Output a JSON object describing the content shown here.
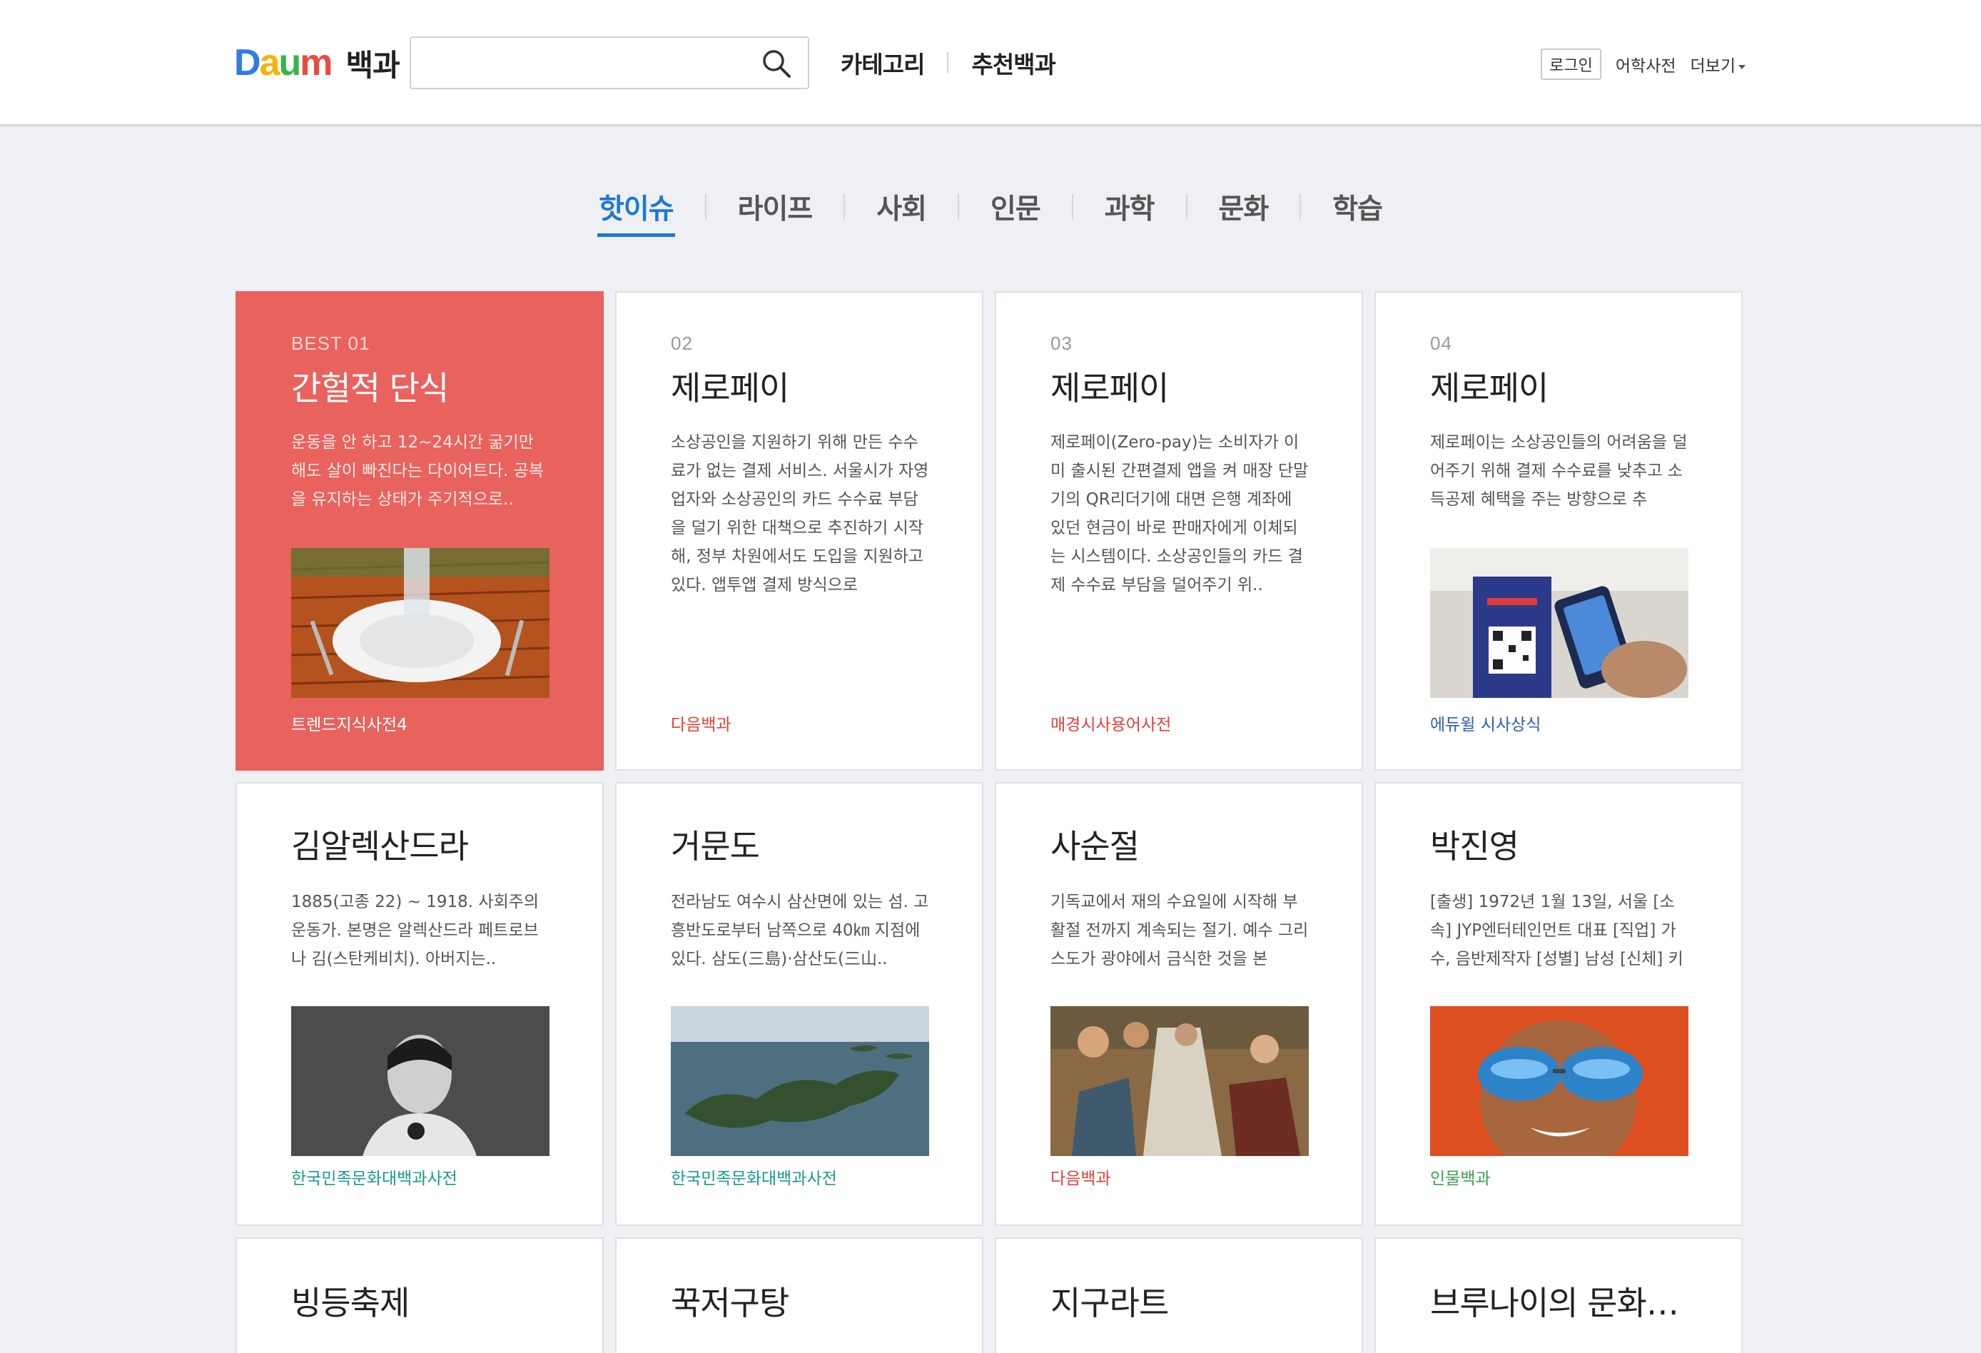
{
  "header": {
    "logo_letters": [
      "D",
      "a",
      "u",
      "m"
    ],
    "logo_title": "백과",
    "search": {
      "value": "",
      "placeholder": ""
    },
    "nav": [
      "카테고리",
      "추천백과"
    ],
    "login": "로그인",
    "dictionary": "어학사전",
    "more": "더보기"
  },
  "colors": {
    "accent": "#1e78d4",
    "best_card": "#e8635e",
    "logo": [
      "#2f7de1",
      "#f5b400",
      "#36b44a",
      "#ea4a3d"
    ]
  },
  "tabs": [
    {
      "label": "핫이슈",
      "active": true
    },
    {
      "label": "라이프",
      "active": false
    },
    {
      "label": "사회",
      "active": false
    },
    {
      "label": "인문",
      "active": false
    },
    {
      "label": "과학",
      "active": false
    },
    {
      "label": "문화",
      "active": false
    },
    {
      "label": "학습",
      "active": false
    }
  ],
  "cards": [
    {
      "rank": "BEST 01",
      "title": "간헐적 단식",
      "desc": "운동을 안 하고 12~24시간 굶기만 해도 살이 빠진다는 다이어트다. 공복을 유지하는 상태가 주기적으로..",
      "image": "plate-with-water-glass",
      "source": "트렌드지식사전4"
    },
    {
      "rank": "02",
      "title": "제로페이",
      "desc": "소상공인을 지원하기 위해 만든 수수료가 없는 결제 서비스. 서울시가 자영업자와 소상공인의 카드 수수료 부담을 덜기 위한 대책으로 추진하기 시작해, 정부 차원에서도 도입을 지원하고 있다. 앱투앱 결제 방식으로",
      "image": "",
      "source": "다음백과"
    },
    {
      "rank": "03",
      "title": "제로페이",
      "desc": "제로페이(Zero-pay)는 소비자가 이미 출시된 간편결제 앱을 켜 매장 단말기의 QR리더기에 대면 은행 계좌에 있던 현금이 바로 판매자에게 이체되는 시스템이다. 소상공인들의 카드 결제 수수료 부담을 덜어주기 위..",
      "image": "",
      "source": "매경시사용어사전"
    },
    {
      "rank": "04",
      "title": "제로페이",
      "desc": "제로페이는 소상공인들의 어려움을 덜어주기 위해 결제 수수료를 낮추고 소득공제 혜택을 주는 방향으로 추",
      "image": "qr-payment-phone",
      "source": "에듀윌 시사상식"
    },
    {
      "rank": "",
      "title": "김알렉산드라",
      "desc": "1885(고종 22) ~ 1918. 사회주의운동가. 본명은 알렉산드라 페트로브나 김(스탄케비치). 아버지는..",
      "image": "historic-portrait",
      "source": "한국민족문화대백과사전"
    },
    {
      "rank": "",
      "title": "거문도",
      "desc": "전라남도 여수시 삼산면에 있는 섬. 고흥반도로부터 남쪽으로 40㎞ 지점에 있다. 삼도(三島)·삼산도(三山..",
      "image": "island-aerial",
      "source": "한국민족문화대백과사전"
    },
    {
      "rank": "",
      "title": "사순절",
      "desc": "기독교에서 재의 수요일에 시작해 부활절 전까지 계속되는 절기. 예수 그리스도가 광야에서 금식한 것을 본",
      "image": "medieval-painting",
      "source": "다음백과"
    },
    {
      "rank": "",
      "title": "박진영",
      "desc": "[출생] 1972년 1월 13일, 서울 [소속] JYP엔터테인먼트 대표 [직업] 가수, 음반제작자 [성별] 남성 [신체] 키",
      "image": "man-with-sunglasses",
      "source": "인물백과"
    },
    {
      "rank": "",
      "title": "빙등축제",
      "desc": "",
      "image": "",
      "source": ""
    },
    {
      "rank": "",
      "title": "꾹저구탕",
      "desc": "",
      "image": "",
      "source": ""
    },
    {
      "rank": "",
      "title": "지구라트",
      "desc": "",
      "image": "",
      "source": ""
    },
    {
      "rank": "",
      "title": "브루나이의 문화…",
      "desc": "",
      "image": "",
      "source": ""
    }
  ]
}
